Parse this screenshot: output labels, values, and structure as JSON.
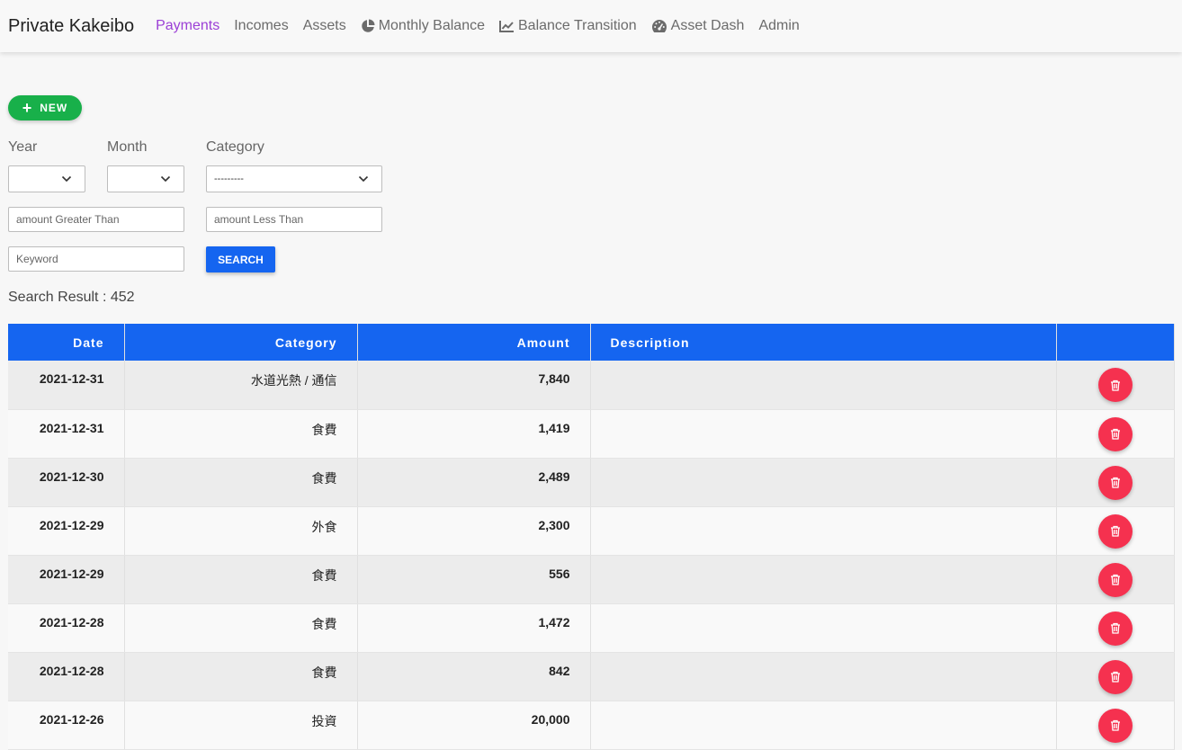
{
  "nav": {
    "brand": "Private Kakeibo",
    "items": [
      {
        "label": "Payments",
        "icon": "",
        "active": true
      },
      {
        "label": "Incomes",
        "icon": ""
      },
      {
        "label": "Assets",
        "icon": ""
      },
      {
        "label": "Monthly Balance",
        "icon": "pie-chart-icon"
      },
      {
        "label": "Balance Transition",
        "icon": "line-chart-icon"
      },
      {
        "label": "Asset Dash",
        "icon": "dashboard-icon"
      },
      {
        "label": "Admin",
        "icon": ""
      }
    ]
  },
  "new_button": {
    "label": "NEW",
    "icon": "plus-icon"
  },
  "filters": {
    "year_label": "Year",
    "month_label": "Month",
    "category_label": "Category",
    "year_value": "",
    "month_value": "",
    "category_value": "---------",
    "amount_gt_placeholder": "amount Greater Than",
    "amount_lt_placeholder": "amount Less Than",
    "keyword_placeholder": "Keyword",
    "search_label": "SEARCH"
  },
  "result": {
    "text": "Search Result : 452"
  },
  "table": {
    "headers": {
      "date": "Date",
      "category": "Category",
      "amount": "Amount",
      "description": "Description"
    },
    "rows": [
      {
        "date": "2021-12-31",
        "category": "水道光熱 / 通信",
        "amount": "7,840",
        "description": ""
      },
      {
        "date": "2021-12-31",
        "category": "食費",
        "amount": "1,419",
        "description": ""
      },
      {
        "date": "2021-12-30",
        "category": "食費",
        "amount": "2,489",
        "description": ""
      },
      {
        "date": "2021-12-29",
        "category": "外食",
        "amount": "2,300",
        "description": ""
      },
      {
        "date": "2021-12-29",
        "category": "食費",
        "amount": "556",
        "description": ""
      },
      {
        "date": "2021-12-28",
        "category": "食費",
        "amount": "1,472",
        "description": ""
      },
      {
        "date": "2021-12-28",
        "category": "食費",
        "amount": "842",
        "description": ""
      },
      {
        "date": "2021-12-26",
        "category": "投資",
        "amount": "20,000",
        "description": ""
      }
    ]
  },
  "colors": {
    "primary": "#1565f0",
    "active_nav": "#9b3fd6",
    "new_button": "#18b04a",
    "delete_button": "#f5314f"
  }
}
